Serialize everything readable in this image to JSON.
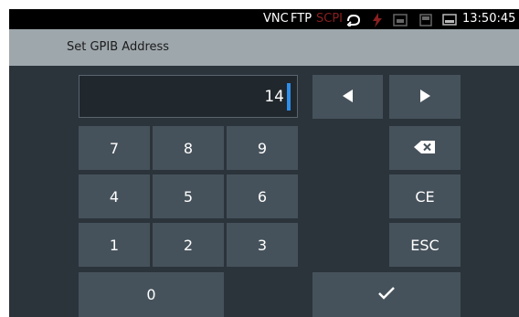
{
  "status_bar": {
    "vnc": "VNC",
    "ftp": "FTP",
    "scpi": "SCPI",
    "time": "13:50:45",
    "icons": [
      "remote-loop-icon",
      "lightning-icon",
      "ethernet-icon",
      "storage-icon",
      "display-icon"
    ]
  },
  "dialog": {
    "title": "Set GPIB Address"
  },
  "display": {
    "value": "14"
  },
  "keypad": {
    "k7": "7",
    "k8": "8",
    "k9": "9",
    "k4": "4",
    "k5": "5",
    "k6": "6",
    "k1": "1",
    "k2": "2",
    "k3": "3",
    "k0": "0",
    "clear_entry": "CE",
    "escape": "ESC"
  },
  "icons": {
    "left": "arrow-left-icon",
    "right": "arrow-right-icon",
    "backspace": "backspace-icon",
    "confirm": "checkmark-icon"
  },
  "colors": {
    "background": "#2b333b",
    "key": "#46525b",
    "display": "#20272d",
    "title_bar": "#9ea7ac",
    "cursor": "#2f8eea",
    "status_bar": "#000000"
  }
}
